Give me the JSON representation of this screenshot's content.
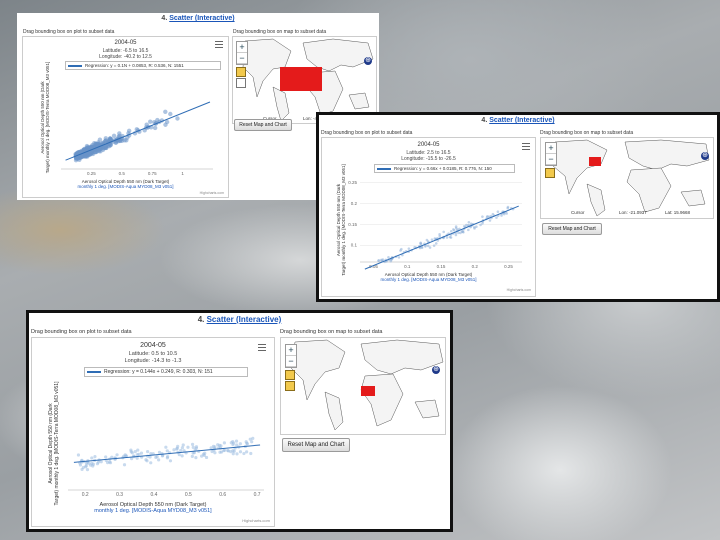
{
  "panels": [
    {
      "title_num": "4.",
      "title_link": "Scatter (Interactive)",
      "hint_plot": "Drag bounding box on plot to subset data",
      "hint_map": "Drag bounding box on map to subset data",
      "button": "Reset Map and Chart",
      "chart_title": "2004-05",
      "sub1": "Latitude: -6.5 to 16.5",
      "sub2": "Longitude: -40.2 to 12.5",
      "legend": "Regression: y = 0.1N + 0.0853, R: 0.536, N: 1551",
      "ylabel1": "Aerosol Optical Depth 550 nm (Dark",
      "ylabel2": "Target) monthly 1 deg. [MODIS-Terra MOD08_M3 v051]",
      "xlabel1": "Aerosol Optical Depth 550 nm (Dark Target)",
      "xlabel2": "monthly 1 deg. [MODIS-Aqua MYD08_M3 v051]",
      "credit": "Highcharts.com",
      "map_left": "Cursor",
      "map_mid": "Lon: -49.3672",
      "map_right": "Lat: 15.5859"
    },
    {
      "title_num": "4.",
      "title_link": "Scatter (Interactive)",
      "hint_plot": "Drag bounding box on plot to subset data",
      "hint_map": "Drag bounding box on map to subset data",
      "button": "Reset Map and Chart",
      "chart_title": "2004-05",
      "sub1": "Latitude: 2.5 to 16.5",
      "sub2": "Longitude: -15.5 to -26.5",
      "legend": "Regression: y = 0.66x + 0.0185, R: 0.776, N: 150",
      "ylabel1": "Aerosol Optical Depth 550 nm (Dark",
      "ylabel2": "Target) monthly 1 deg. [MODIS-Terra MOD08_M3 v051]",
      "xlabel1": "Aerosol Optical Depth 550 nm (Dark Target)",
      "xlabel2": "monthly 1 deg. [MODIS-Aqua MYD08_M3 v051]",
      "credit": "Highcharts.com",
      "map_left": "Cursor",
      "map_mid": "Lon: -21.0937",
      "map_right": "Lat: 15.9668"
    },
    {
      "title_num": "4.",
      "title_link": "Scatter (Interactive)",
      "hint_plot": "Drag bounding box on plot to subset data",
      "hint_map": "Drag bounding box on map to subset data",
      "button": "Reset Map and Chart",
      "chart_title": "2004-05",
      "sub1": "Latitude: 0.5 to 10.5",
      "sub2": "Longitude: -14.3 to -1.3",
      "legend": "Regression: y = 0.144x + 0.249, R: 0.303, N: 151",
      "ylabel1": "Aerosol Optical Depth 550 nm (Dark",
      "ylabel2": "Target) monthly 1 deg. [MODIS-Terra MOD08_M3 v051]",
      "xlabel1": "Aerosol Optical Depth 550 nm (Dark Target)",
      "xlabel2": "monthly 1 deg. [MODIS-Aqua MYD08_M3 v051]",
      "credit": "Highcharts.com"
    }
  ],
  "icons": {
    "zoom_in": "+",
    "zoom_out": "−",
    "nav": "⊕"
  },
  "chart_data": [
    {
      "type": "scatter",
      "title": "2004-05",
      "xlabel": "Aerosol Optical Depth 550 nm (Dark Target) monthly 1 deg. [MODIS-Aqua MYD08_M3 v051]",
      "ylabel": "Aerosol Optical Depth 550 nm (Dark Target) monthly 1 deg. [MODIS-Terra MOD08_M3 v051]",
      "x_ticks": [
        0.25,
        0.5,
        0.75,
        1
      ],
      "y_ticks": [],
      "xlim": [
        0,
        1.25
      ],
      "ylim": [
        0,
        1.2
      ],
      "regression": {
        "slope": 0.6,
        "intercept": 0.0853
      },
      "point_color": "#6a93c9",
      "line_color": "#2f6db5",
      "series": [
        {
          "name": "Regression",
          "values": []
        }
      ],
      "n_points": 1551
    },
    {
      "type": "scatter",
      "title": "2004-05",
      "xlabel": "Aerosol Optical Depth 550 nm (Dark Target) monthly 1 deg. [MODIS-Aqua MYD08_M3 v051]",
      "ylabel": "Aerosol Optical Depth 550 nm (Dark Target) monthly 1 deg. [MODIS-Terra MOD08_M3 v051]",
      "x_ticks": [
        0.05,
        0.1,
        0.15,
        0.2,
        0.25
      ],
      "y_ticks": [
        0.1,
        0.15,
        0.2,
        0.25
      ],
      "xlim": [
        0.03,
        0.27
      ],
      "ylim": [
        0.06,
        0.27
      ],
      "regression": {
        "slope": 0.66,
        "intercept": 0.0185
      },
      "point_color": "#8fb0d8",
      "line_color": "#2f6db5",
      "series": [
        {
          "name": "Regression",
          "values": []
        }
      ],
      "n_points": 150
    },
    {
      "type": "scatter",
      "title": "2004-05",
      "xlabel": "Aerosol Optical Depth 550 nm (Dark Target) monthly 1 deg. [MODIS-Aqua MYD08_M3 v051]",
      "ylabel": "Aerosol Optical Depth 550 nm (Dark Target) monthly 1 deg. [MODIS-Terra MOD08_M3 v051]",
      "x_ticks": [
        0.2,
        0.3,
        0.4,
        0.5,
        0.6,
        0.7
      ],
      "y_ticks": [],
      "xlim": [
        0.15,
        0.72
      ],
      "ylim": [
        0.15,
        0.65
      ],
      "regression": {
        "slope": 0.144,
        "intercept": 0.249
      },
      "point_color": "#9bbbe0",
      "line_color": "#2f6db5",
      "series": [
        {
          "name": "Regression",
          "values": []
        }
      ],
      "n_points": 151
    }
  ]
}
